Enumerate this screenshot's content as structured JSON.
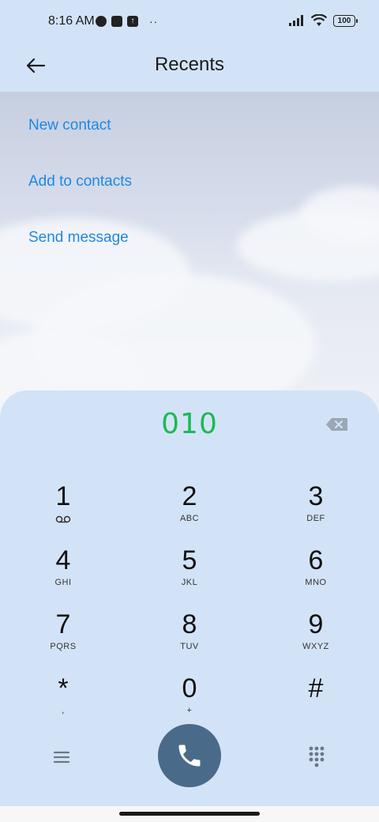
{
  "status_bar": {
    "time": "8:16 AM",
    "battery": "100"
  },
  "header": {
    "title": "Recents"
  },
  "actions": {
    "new_contact": "New contact",
    "add_to_contacts": "Add to contacts",
    "send_message": "Send message"
  },
  "dialer": {
    "number": "010",
    "keys": [
      {
        "digit": "1",
        "letters": "voicemail-icon"
      },
      {
        "digit": "2",
        "letters": "ABC"
      },
      {
        "digit": "3",
        "letters": "DEF"
      },
      {
        "digit": "4",
        "letters": "GHI"
      },
      {
        "digit": "5",
        "letters": "JKL"
      },
      {
        "digit": "6",
        "letters": "MNO"
      },
      {
        "digit": "7",
        "letters": "PQRS"
      },
      {
        "digit": "8",
        "letters": "TUV"
      },
      {
        "digit": "9",
        "letters": "WXYZ"
      },
      {
        "digit": "*",
        "letters": ","
      },
      {
        "digit": "0",
        "letters": "+"
      },
      {
        "digit": "#",
        "letters": ""
      }
    ]
  },
  "colors": {
    "accent_link": "#1e88e5",
    "number": "#1db954",
    "call_button": "#4a6a8a",
    "panel": "#d3e3f7"
  }
}
